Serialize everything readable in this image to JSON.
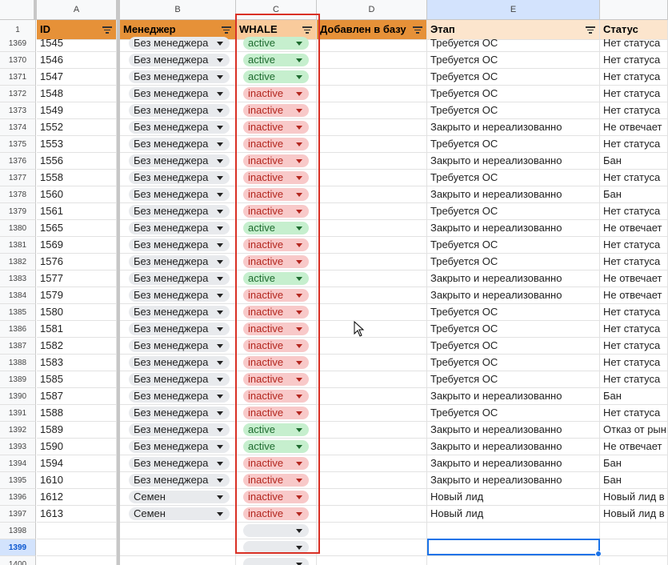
{
  "columns": [
    "A",
    "B",
    "C",
    "D",
    "E"
  ],
  "header_row_number": "1",
  "headers": {
    "id": "ID",
    "manager": "Менеджер",
    "whale": "WHALE",
    "added": "Добавлен в базу",
    "stage": "Этап",
    "status": "Статус"
  },
  "rows": [
    {
      "n": "1369",
      "id": "1545",
      "mgr": "Без менеджера",
      "whale": "active",
      "stage": "Требуется ОС",
      "status": "Нет статуса"
    },
    {
      "n": "1370",
      "id": "1546",
      "mgr": "Без менеджера",
      "whale": "active",
      "stage": "Требуется ОС",
      "status": "Нет статуса"
    },
    {
      "n": "1371",
      "id": "1547",
      "mgr": "Без менеджера",
      "whale": "active",
      "stage": "Требуется ОС",
      "status": "Нет статуса"
    },
    {
      "n": "1372",
      "id": "1548",
      "mgr": "Без менеджера",
      "whale": "inactive",
      "stage": "Требуется ОС",
      "status": "Нет статуса"
    },
    {
      "n": "1373",
      "id": "1549",
      "mgr": "Без менеджера",
      "whale": "inactive",
      "stage": "Требуется ОС",
      "status": "Нет статуса"
    },
    {
      "n": "1374",
      "id": "1552",
      "mgr": "Без менеджера",
      "whale": "inactive",
      "stage": "Закрыто и нереализованно",
      "status": "Не отвечает"
    },
    {
      "n": "1375",
      "id": "1553",
      "mgr": "Без менеджера",
      "whale": "inactive",
      "stage": "Требуется ОС",
      "status": "Нет статуса"
    },
    {
      "n": "1376",
      "id": "1556",
      "mgr": "Без менеджера",
      "whale": "inactive",
      "stage": "Закрыто и нереализованно",
      "status": "Бан"
    },
    {
      "n": "1377",
      "id": "1558",
      "mgr": "Без менеджера",
      "whale": "inactive",
      "stage": "Требуется ОС",
      "status": "Нет статуса"
    },
    {
      "n": "1378",
      "id": "1560",
      "mgr": "Без менеджера",
      "whale": "inactive",
      "stage": "Закрыто и нереализованно",
      "status": "Бан"
    },
    {
      "n": "1379",
      "id": "1561",
      "mgr": "Без менеджера",
      "whale": "inactive",
      "stage": "Требуется ОС",
      "status": "Нет статуса"
    },
    {
      "n": "1380",
      "id": "1565",
      "mgr": "Без менеджера",
      "whale": "active",
      "stage": "Закрыто и нереализованно",
      "status": "Не отвечает"
    },
    {
      "n": "1381",
      "id": "1569",
      "mgr": "Без менеджера",
      "whale": "inactive",
      "stage": "Требуется ОС",
      "status": "Нет статуса"
    },
    {
      "n": "1382",
      "id": "1576",
      "mgr": "Без менеджера",
      "whale": "inactive",
      "stage": "Требуется ОС",
      "status": "Нет статуса"
    },
    {
      "n": "1383",
      "id": "1577",
      "mgr": "Без менеджера",
      "whale": "active",
      "stage": "Закрыто и нереализованно",
      "status": "Не отвечает"
    },
    {
      "n": "1384",
      "id": "1579",
      "mgr": "Без менеджера",
      "whale": "inactive",
      "stage": "Закрыто и нереализованно",
      "status": "Не отвечает"
    },
    {
      "n": "1385",
      "id": "1580",
      "mgr": "Без менеджера",
      "whale": "inactive",
      "stage": "Требуется ОС",
      "status": "Нет статуса"
    },
    {
      "n": "1386",
      "id": "1581",
      "mgr": "Без менеджера",
      "whale": "inactive",
      "stage": "Требуется ОС",
      "status": "Нет статуса"
    },
    {
      "n": "1387",
      "id": "1582",
      "mgr": "Без менеджера",
      "whale": "inactive",
      "stage": "Требуется ОС",
      "status": "Нет статуса"
    },
    {
      "n": "1388",
      "id": "1583",
      "mgr": "Без менеджера",
      "whale": "inactive",
      "stage": "Требуется ОС",
      "status": "Нет статуса"
    },
    {
      "n": "1389",
      "id": "1585",
      "mgr": "Без менеджера",
      "whale": "inactive",
      "stage": "Требуется ОС",
      "status": "Нет статуса"
    },
    {
      "n": "1390",
      "id": "1587",
      "mgr": "Без менеджера",
      "whale": "inactive",
      "stage": "Закрыто и нереализованно",
      "status": "Бан"
    },
    {
      "n": "1391",
      "id": "1588",
      "mgr": "Без менеджера",
      "whale": "inactive",
      "stage": "Требуется ОС",
      "status": "Нет статуса"
    },
    {
      "n": "1392",
      "id": "1589",
      "mgr": "Без менеджера",
      "whale": "active",
      "stage": "Закрыто и нереализованно",
      "status": "Отказ от рын"
    },
    {
      "n": "1393",
      "id": "1590",
      "mgr": "Без менеджера",
      "whale": "active",
      "stage": "Закрыто и нереализованно",
      "status": "Не отвечает"
    },
    {
      "n": "1394",
      "id": "1594",
      "mgr": "Без менеджера",
      "whale": "inactive",
      "stage": "Закрыто и нереализованно",
      "status": "Бан"
    },
    {
      "n": "1395",
      "id": "1610",
      "mgr": "Без менеджера",
      "whale": "inactive",
      "stage": "Закрыто и нереализованно",
      "status": "Бан"
    },
    {
      "n": "1396",
      "id": "1612",
      "mgr": "Семен",
      "whale": "inactive",
      "stage": "Новый лид",
      "status": "Новый лид в"
    },
    {
      "n": "1397",
      "id": "1613",
      "mgr": "Семен",
      "whale": "inactive",
      "stage": "Новый лид",
      "status": "Новый лид в"
    },
    {
      "n": "1398",
      "id": "",
      "mgr": "",
      "whale": "",
      "stage": "",
      "status": ""
    },
    {
      "n": "1399",
      "id": "",
      "mgr": "",
      "whale": "",
      "stage": "",
      "status": ""
    },
    {
      "n": "1400",
      "id": "",
      "mgr": "",
      "whale": "",
      "stage": "",
      "status": ""
    }
  ],
  "selected_row": "1399"
}
